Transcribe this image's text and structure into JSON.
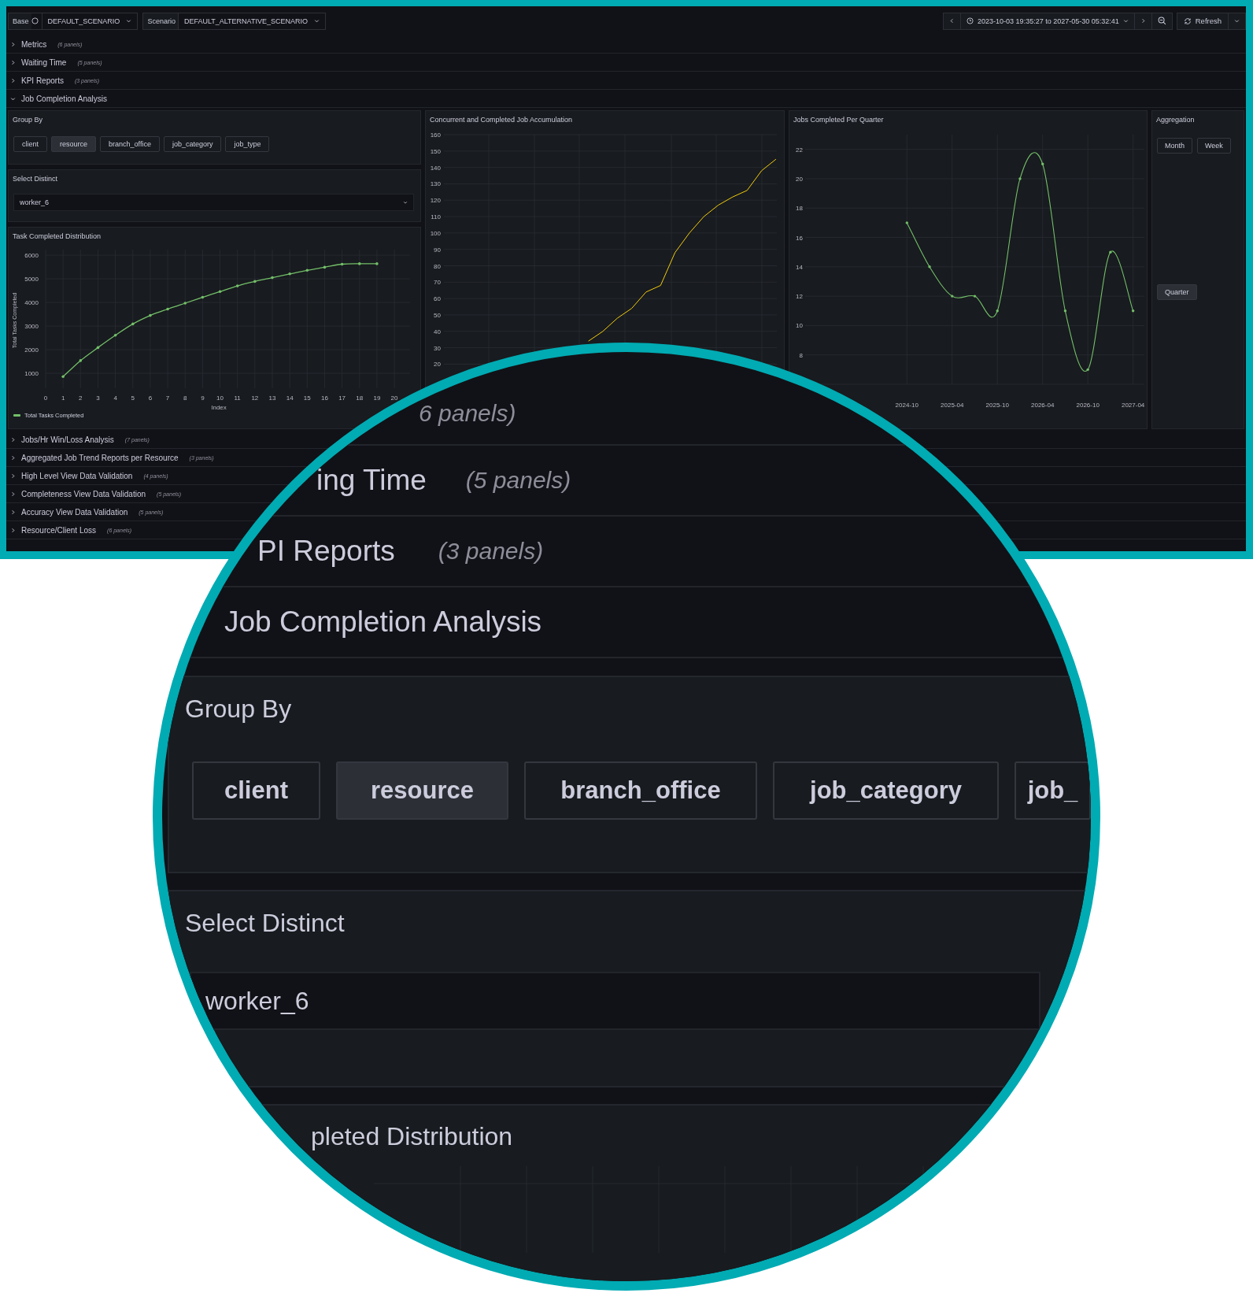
{
  "toolbar": {
    "variables": [
      {
        "label": "Base",
        "value": "DEFAULT_SCENARIO",
        "info": true
      },
      {
        "label": "Scenario",
        "value": "DEFAULT_ALTERNATIVE_SCENARIO",
        "info": false
      }
    ],
    "time_range": "2023-10-03 19:35:27 to 2027-05-30 05:32:41",
    "refresh": "Refresh"
  },
  "rows_above": [
    {
      "title": "Metrics",
      "count": "(6 panels)",
      "expanded": false
    },
    {
      "title": "Waiting Time",
      "count": "(5 panels)",
      "expanded": false
    },
    {
      "title": "KPI Reports",
      "count": "(3 panels)",
      "expanded": false
    },
    {
      "title": "Job Completion Analysis",
      "expanded": true
    }
  ],
  "group_by": {
    "title": "Group By",
    "options": [
      {
        "label": "client",
        "selected": false
      },
      {
        "label": "resource",
        "selected": true
      },
      {
        "label": "branch_office",
        "selected": false
      },
      {
        "label": "job_category",
        "selected": false
      },
      {
        "label": "job_type",
        "selected": false
      }
    ]
  },
  "select_distinct": {
    "title": "Select Distinct",
    "value": "worker_6"
  },
  "task_chart": {
    "title": "Task Completed Distribution",
    "chart_data": {
      "type": "line",
      "xlabel": "Index",
      "ylabel": "Total Tasks Completed",
      "grid": true,
      "x": [
        1,
        2,
        3,
        4,
        5,
        6,
        7,
        8,
        9,
        10,
        11,
        12,
        13,
        14,
        15,
        16,
        17,
        18,
        19
      ],
      "series": [
        {
          "name": "Total Tasks Completed",
          "color": "#73bf69",
          "values": [
            860,
            1540,
            2090,
            2610,
            3090,
            3450,
            3720,
            3970,
            4220,
            4460,
            4700,
            4890,
            5050,
            5210,
            5360,
            5490,
            5620,
            5640,
            5640
          ]
        }
      ],
      "xlim": [
        0,
        20.9
      ],
      "ylim": [
        370,
        6150
      ],
      "xticks": [
        0,
        1,
        2,
        3,
        4,
        5,
        6,
        7,
        8,
        9,
        10,
        11,
        12,
        13,
        14,
        15,
        16,
        17,
        18,
        19,
        20
      ],
      "yticks": [
        1000,
        2000,
        3000,
        4000,
        5000,
        6000
      ]
    }
  },
  "accumulation_chart": {
    "title": "Concurrent and Completed Job Accumulation",
    "chart_data": {
      "type": "line",
      "grid": true,
      "categories": [
        null,
        null,
        null,
        null,
        null,
        null,
        null,
        null,
        null,
        null,
        null,
        null,
        null,
        null
      ],
      "series": [
        {
          "color": "#f2cc0c",
          "values": [
            34,
            40,
            48,
            54,
            64,
            68,
            88,
            100,
            110,
            117,
            122,
            126,
            138,
            145
          ]
        }
      ],
      "ylim": [
        0,
        160
      ],
      "yticks": [
        20,
        30,
        40,
        50,
        60,
        70,
        80,
        90,
        100,
        110,
        120,
        130,
        140,
        150,
        160
      ]
    }
  },
  "quarter_chart": {
    "title": "Jobs Completed Per Quarter",
    "chart_data": {
      "type": "line",
      "grid": true,
      "categories": [
        null,
        null,
        null,
        null,
        "2024-10",
        null,
        "2025-04",
        null,
        "2025-10",
        null,
        "2026-04",
        null,
        "2026-10",
        null,
        "2027-04"
      ],
      "series": [
        {
          "color": "#73bf69",
          "values": [
            null,
            null,
            null,
            null,
            17,
            14,
            12,
            12,
            11,
            20,
            21,
            11,
            7,
            15,
            11
          ]
        }
      ],
      "ylim": [
        6,
        23
      ],
      "yticks": [
        8,
        10,
        12,
        14,
        16,
        18,
        20,
        22
      ]
    }
  },
  "aggregation": {
    "title": "Aggregation",
    "options": [
      {
        "label": "Month",
        "selected": false
      },
      {
        "label": "Week",
        "selected": false
      },
      {
        "label": "Quarter",
        "selected": true
      }
    ]
  },
  "rows_below": [
    {
      "title": "Jobs/Hr Win/Loss Analysis",
      "count": "(7 panels)",
      "expanded": false
    },
    {
      "title": "Aggregated Job Trend Reports per Resource",
      "count": "(3 panels)",
      "expanded": false
    },
    {
      "title": "High Level View Data Validation",
      "count": "(4 panels)",
      "expanded": false
    },
    {
      "title": "Completeness View Data Validation",
      "count": "(5 panels)",
      "expanded": false
    },
    {
      "title": "Accuracy View Data Validation",
      "count": "(5 panels)",
      "expanded": false
    },
    {
      "title": "Resource/Client Loss",
      "count": "(6 panels)",
      "expanded": false
    }
  ],
  "magnifier": {
    "rows": [
      {
        "count": "6 panels)"
      },
      {
        "title": "ing Time",
        "count": "(5 panels)"
      },
      {
        "title": "PI Reports",
        "count": "(3 panels)"
      },
      {
        "title": "Job Completion Analysis"
      }
    ],
    "group_by": {
      "title": "Group By",
      "options": [
        {
          "label": "client",
          "selected": false
        },
        {
          "label": "resource",
          "selected": true
        },
        {
          "label": "branch_office",
          "selected": false
        },
        {
          "label": "job_category",
          "selected": false
        },
        {
          "label": "job_",
          "selected": false
        }
      ]
    },
    "select_distinct": {
      "title": "Select Distinct",
      "value": "worker_6"
    },
    "panel_title": "pleted Distribution"
  }
}
